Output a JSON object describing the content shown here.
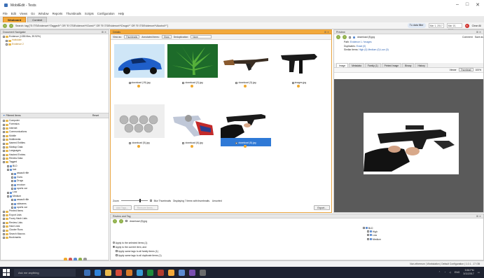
{
  "window": {
    "title": "MobilEdit - Tests",
    "controls": [
      "–",
      "□",
      "✕"
    ]
  },
  "menu": [
    "File",
    "Edit",
    "Views",
    "Go",
    "Window",
    "Reports",
    "Thumbnails",
    "Scripts",
    "Configuration",
    "Help"
  ],
  "tabs": [
    {
      "label": "Weaboard",
      "active": true
    },
    {
      "label": "Content",
      "active": false
    }
  ],
  "pathbar": {
    "text": "Search: tag:[\"E:\\TS\\Evidence\\*\\Tagged\\*\" OR \"E:\\TS\\Evidence\\*\\Guns\\*\" OR \"E:\\TS\\Evidence\\*\\Drugs\\*\" OR \"E:\\TS\\Evidence\\*\\Alcohol\\*\"]",
    "right_pill": "Tu data filter",
    "date_from": "Mar 1, 2017",
    "date_to": "Mar 10, 2017",
    "clear_all": "Clear All"
  },
  "left_panel": {
    "title": "Document Navigator",
    "evidence_rows": [
      "Evidence (1355 files, 39.92%)",
      "Hotfolder",
      "Evidence 2"
    ],
    "filter_title": "Filtered Items",
    "reset": "Reset",
    "filters": [
      "Computer",
      "Forensics",
      "Internet",
      "Communications",
      "Mobile",
      "Multimedia",
      "Named Entities",
      "Markup Data",
      "Languages",
      "Hashed Entries",
      "Review Data",
      "Tagged"
    ],
    "tagged_children": [
      "BLD",
      "lost",
      "assault rifle",
      "Guns",
      "Drugs",
      "revolver",
      "sports car",
      "Low",
      "Medium",
      "assault rifle",
      "sidearms",
      "sports car"
    ],
    "bottom_filters": [
      "Printed Items",
      "Export Lists",
      "Fuzzy Hash Lists",
      "Review Lists",
      "Hard Lists",
      "Cluster Runs",
      "Search Macros",
      "Bookmarks"
    ]
  },
  "results_panel": {
    "title": "Details",
    "view_as_label": "View as:",
    "view_as": "Thumbnails",
    "group_label": "Annotated items:",
    "group_value": "Show",
    "dedup_label": "Deduplication:",
    "dedup_value": "None",
    "thumbs": [
      {
        "name": "download (19).jpg",
        "kind": "car"
      },
      {
        "name": "download (2).jpg",
        "kind": "leaf"
      },
      {
        "name": "download (3).jpg",
        "kind": "rifle"
      },
      {
        "name": "images.jpg",
        "kind": "smg"
      },
      {
        "name": "download (5).jpg",
        "kind": "pills"
      },
      {
        "name": "download (6).jpg",
        "kind": "revolver"
      },
      {
        "name": "download (8).jpg",
        "kind": "gunhand",
        "selected": true
      }
    ],
    "zoom_label": "Zoom",
    "blur_label": "Blur Thumbnails",
    "status": "Displaying 7 items with thumbnails.",
    "status2": "Unsorted",
    "btn_add": "Add Tags...",
    "btn_remove": "Remove Items...",
    "btn_export": "Export..."
  },
  "preview_panel": {
    "title": "Preview",
    "filename": "download (8).jpg",
    "path_label": "Path:",
    "path_value": "Evidence 1 / Images",
    "dup_label": "Duplicates:",
    "dup_value": "Exact (0)",
    "similar_label": "Similar items:",
    "similar_value": "High (0)  Medium (0)  Low (0)",
    "comment": "Comment",
    "save_as": "Save as",
    "tabs": [
      "Image",
      "Metadata",
      "Family (1)",
      "Printed Image",
      "Binary",
      "History"
    ],
    "viewer_label": "Viewer",
    "zoom_mode": "Thumbnail",
    "zoom_value": "100%"
  },
  "review_panel": {
    "title": "Review and Tag",
    "filename": "download (8).jpg",
    "option1": "Apply to the selected items (1)",
    "option2": "Apply to the current item, and",
    "option3": "Apply same tags to all family items (1)",
    "option4": "Apply same tags to all duplicate items (1)",
    "tag_tree": [
      "BLD",
      "High",
      "Low",
      "Medium"
    ]
  },
  "status_bar": {
    "right": "Non-ethereum  |  Workstation  |  Default Configuration  |  1.0.1 - 17 GB"
  },
  "taskbar": {
    "search_placeholder": "Ask me anything",
    "time": "5:56 PM",
    "date": "3/11/2017",
    "lang": "ENG"
  },
  "colors": {
    "accent": "#f2a93b",
    "selection": "#2f79d6",
    "taskbar": "#1e2230"
  }
}
